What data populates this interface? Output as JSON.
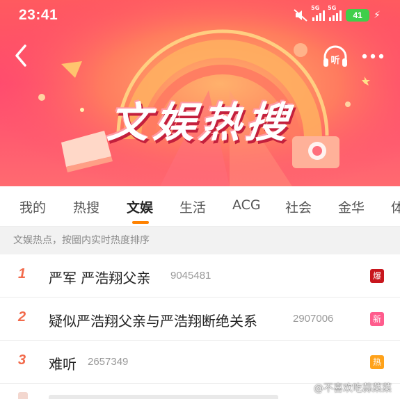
{
  "status_bar": {
    "time": "23:41",
    "network_1": "5G",
    "network_2": "5G",
    "battery": "41",
    "icons": [
      "mute-icon",
      "signal-icon",
      "signal-icon",
      "battery-icon",
      "charging-icon"
    ]
  },
  "header": {
    "banner_title": "文娱热搜",
    "back_icon": "chevron-left-icon",
    "listen_label": "听",
    "more_icon": "more-icon"
  },
  "tabs": [
    {
      "label": "我的"
    },
    {
      "label": "热搜"
    },
    {
      "label": "文娱"
    },
    {
      "label": "生活"
    },
    {
      "label": "ACG"
    },
    {
      "label": "社会"
    },
    {
      "label": "金华"
    },
    {
      "label": "体"
    }
  ],
  "active_tab": "文娱",
  "description": "文娱热点，按圈内实时热度排序",
  "hot_list": [
    {
      "rank": "1",
      "title": "严军 严浩翔父亲",
      "count": "9045481",
      "badge": "爆",
      "badge_color": "#c8161d"
    },
    {
      "rank": "2",
      "title": "疑似严浩翔父亲与严浩翔断绝关系",
      "count": "2907006",
      "badge": "新",
      "badge_color": "#ff5c8d"
    },
    {
      "rank": "3",
      "title": "难听",
      "count": "2657349",
      "badge": "热",
      "badge_color": "#ffa21a"
    }
  ],
  "watermark": "@不喜欢吃蒜菜菜",
  "colors": {
    "accent": "#ff8200",
    "rank": "#f26a4b",
    "banner": "#ff4b6e"
  }
}
